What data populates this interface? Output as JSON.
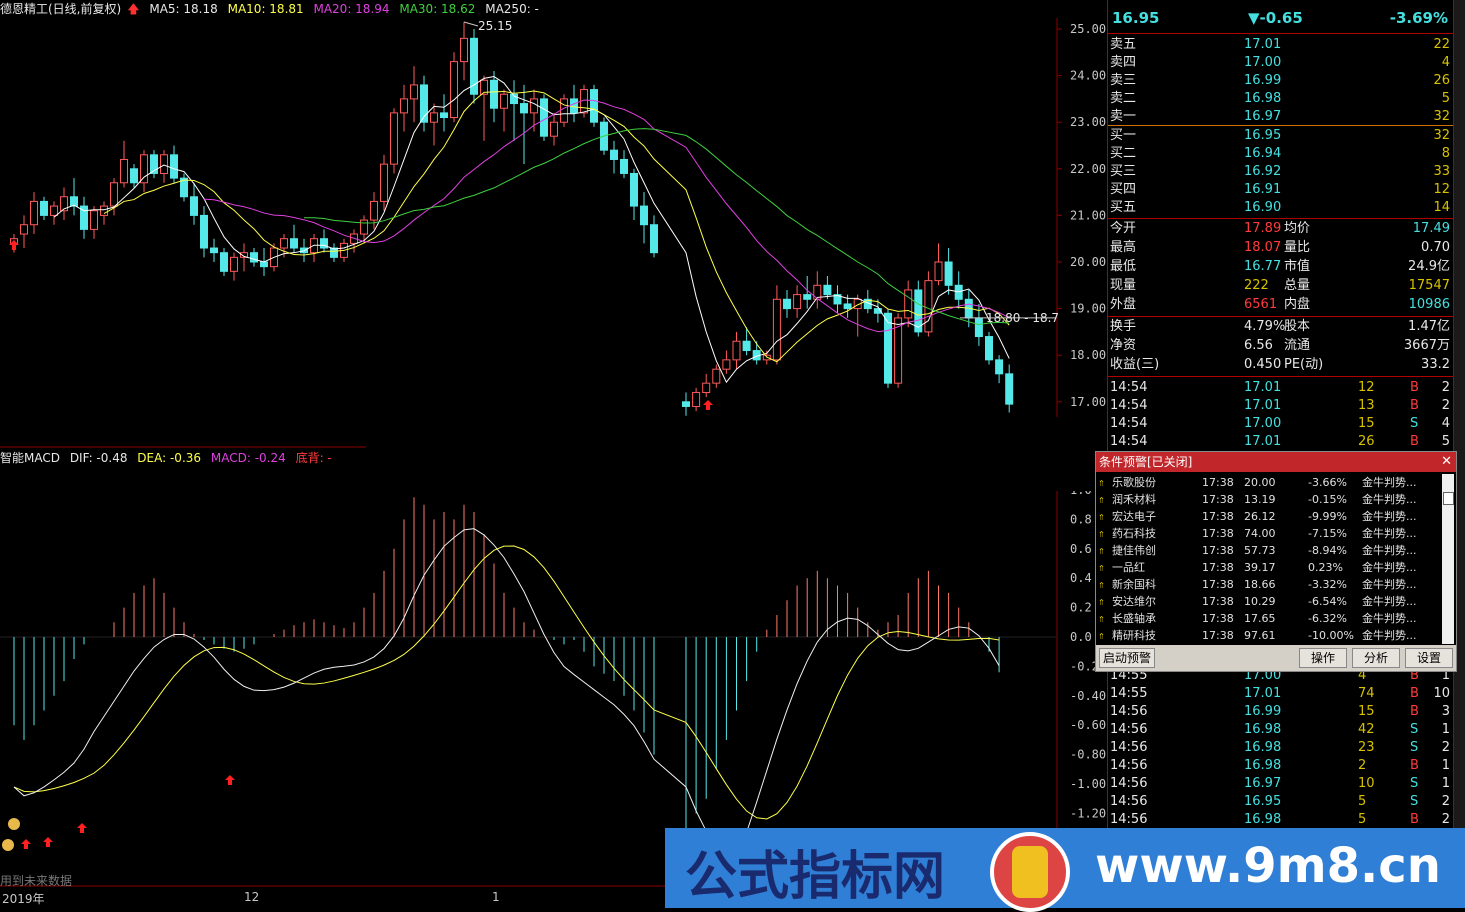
{
  "main_legend": {
    "stock": "德恩精工(日线,前复权)",
    "ma5": "MA5: 18.18",
    "ma10": "MA10: 18.81",
    "ma20": "MA20: 18.94",
    "ma30": "MA30: 18.62",
    "ma250": "MA250: -",
    "colors": {
      "ma5": "#ffffff",
      "ma10": "#ffff4a",
      "ma20": "#e040e0",
      "ma30": "#40d040"
    }
  },
  "macd_legend": {
    "name": "智能MACD",
    "dif": "DIF: -0.48",
    "dea": "DEA: -0.36",
    "macd": "MACD: -0.24",
    "extra": "底背: -"
  },
  "annotations": {
    "high_label": "25.15",
    "range_label": "18.80 - 18.7",
    "footer_note": "用到未来数据"
  },
  "price_axis": [
    "25.00",
    "24.00",
    "23.00",
    "22.00",
    "21.00",
    "20.00",
    "19.00",
    "18.00",
    "17.00"
  ],
  "macd_axis": [
    "1.0",
    "0.8",
    "0.6",
    "0.4",
    "0.2",
    "0.0",
    "-0.20",
    "-0.40",
    "-0.60",
    "-0.80",
    "-1.00",
    "-1.20"
  ],
  "date_axis": {
    "year": "2019年",
    "m12": "12",
    "m1": "1"
  },
  "quote_header": {
    "price": "16.95",
    "change": "▼-0.65",
    "pct": "-3.69%"
  },
  "order_book": [
    {
      "label": "卖五",
      "price": "17.01",
      "vol": "22"
    },
    {
      "label": "卖四",
      "price": "17.00",
      "vol": "4"
    },
    {
      "label": "卖三",
      "price": "16.99",
      "vol": "26"
    },
    {
      "label": "卖二",
      "price": "16.98",
      "vol": "5"
    },
    {
      "label": "卖一",
      "price": "16.97",
      "vol": "32"
    },
    {
      "label": "买一",
      "price": "16.95",
      "vol": "32"
    },
    {
      "label": "买二",
      "price": "16.94",
      "vol": "8"
    },
    {
      "label": "买三",
      "price": "16.92",
      "vol": "33"
    },
    {
      "label": "买四",
      "price": "16.91",
      "vol": "12"
    },
    {
      "label": "买五",
      "price": "16.90",
      "vol": "14"
    }
  ],
  "stats": [
    {
      "l1": "今开",
      "v1": "17.89",
      "l2": "均价",
      "v2": "17.49"
    },
    {
      "l1": "最高",
      "v1": "18.07",
      "l2": "量比",
      "v2": "0.70"
    },
    {
      "l1": "最低",
      "v1": "16.77",
      "l2": "市值",
      "v2": "24.9亿"
    },
    {
      "l1": "现量",
      "v1": "222",
      "l2": "总量",
      "v2": "17547"
    },
    {
      "l1": "外盘",
      "v1": "6561",
      "l2": "内盘",
      "v2": "10986"
    }
  ],
  "stats2": [
    {
      "l1": "换手",
      "v1": "4.79%",
      "l2": "股本",
      "v2": "1.47亿"
    },
    {
      "l1": "净资",
      "v1": "6.56",
      "l2": "流通",
      "v2": "3667万"
    },
    {
      "l1": "收益(三)",
      "v1": "0.450",
      "l2": "PE(动)",
      "v2": "33.2"
    }
  ],
  "ticks_top": [
    {
      "t": "14:54",
      "p": "17.01",
      "v": "12",
      "d": "B",
      "n": "2"
    },
    {
      "t": "14:54",
      "p": "17.01",
      "v": "13",
      "d": "B",
      "n": "2"
    },
    {
      "t": "14:54",
      "p": "17.00",
      "v": "15",
      "d": "S",
      "n": "4"
    },
    {
      "t": "14:54",
      "p": "17.01",
      "v": "26",
      "d": "B",
      "n": "5"
    }
  ],
  "ticks_bottom": [
    {
      "t": "14:55",
      "p": "17.00",
      "v": "4",
      "d": "B",
      "n": "1"
    },
    {
      "t": "14:55",
      "p": "17.01",
      "v": "74",
      "d": "B",
      "n": "10"
    },
    {
      "t": "14:56",
      "p": "16.99",
      "v": "15",
      "d": "B",
      "n": "3"
    },
    {
      "t": "14:56",
      "p": "16.98",
      "v": "42",
      "d": "S",
      "n": "1"
    },
    {
      "t": "14:56",
      "p": "16.98",
      "v": "23",
      "d": "S",
      "n": "2"
    },
    {
      "t": "14:56",
      "p": "16.98",
      "v": "2",
      "d": "B",
      "n": "1"
    },
    {
      "t": "14:56",
      "p": "16.97",
      "v": "10",
      "d": "S",
      "n": "1"
    },
    {
      "t": "14:56",
      "p": "16.95",
      "v": "5",
      "d": "S",
      "n": "2"
    },
    {
      "t": "14:56",
      "p": "16.98",
      "v": "5",
      "d": "B",
      "n": "2"
    }
  ],
  "alert_window": {
    "title": "条件预警[已关闭]",
    "rows": [
      {
        "name": "乐歌股份",
        "time": "17:38",
        "price": "20.00",
        "pct": "-3.66%",
        "cond": "金牛判势..."
      },
      {
        "name": "润禾材料",
        "time": "17:38",
        "price": "13.19",
        "pct": "-0.15%",
        "cond": "金牛判势..."
      },
      {
        "name": "宏达电子",
        "time": "17:38",
        "price": "26.12",
        "pct": "-9.99%",
        "cond": "金牛判势..."
      },
      {
        "name": "药石科技",
        "time": "17:38",
        "price": "74.00",
        "pct": "-7.15%",
        "cond": "金牛判势..."
      },
      {
        "name": "捷佳伟创",
        "time": "17:38",
        "price": "57.73",
        "pct": "-8.94%",
        "cond": "金牛判势..."
      },
      {
        "name": "一品红",
        "time": "17:38",
        "price": "39.17",
        "pct": "0.23%",
        "cond": "金牛判势..."
      },
      {
        "name": "新余国科",
        "time": "17:38",
        "price": "18.66",
        "pct": "-3.32%",
        "cond": "金牛判势..."
      },
      {
        "name": "安达维尔",
        "time": "17:38",
        "price": "10.29",
        "pct": "-6.54%",
        "cond": "金牛判势..."
      },
      {
        "name": "长盛轴承",
        "time": "17:38",
        "price": "17.65",
        "pct": "-6.32%",
        "cond": "金牛判势..."
      },
      {
        "name": "精研科技",
        "time": "17:38",
        "price": "97.61",
        "pct": "-10.00%",
        "cond": "金牛判势..."
      }
    ],
    "buttons": {
      "start": "启动预警",
      "op": "操作",
      "analyze": "分析",
      "settings": "设置"
    }
  },
  "watermark": {
    "cn": "公式指标网",
    "url": "www.9m8.cn"
  }
}
